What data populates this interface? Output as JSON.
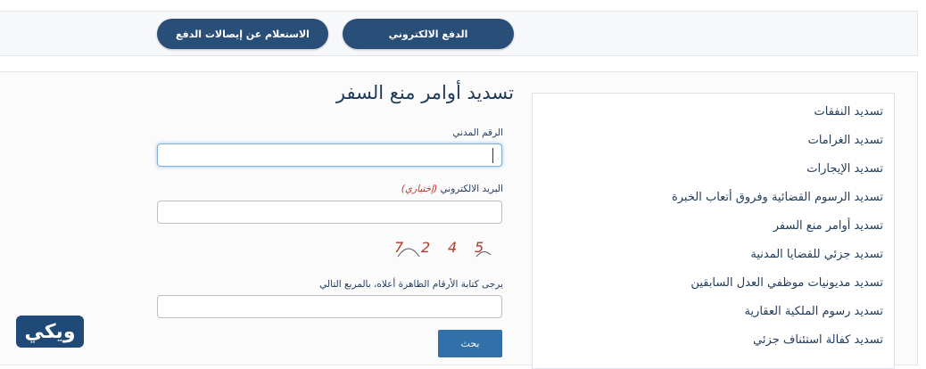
{
  "nav": {
    "epay_label": "الدفع الالكتروني",
    "receipts_label": "الاستعلام عن إيصالات الدفع"
  },
  "sidebar": {
    "items": [
      {
        "label": "تسديد النفقات"
      },
      {
        "label": "تسديد الغرامات"
      },
      {
        "label": "تسديد الإيجارات"
      },
      {
        "label": "تسديد الرسوم القضائية وفروق أتعاب الخبرة"
      },
      {
        "label": "تسديد أوامر منع السفر"
      },
      {
        "label": "تسديد جزئي للقضايا المدنية"
      },
      {
        "label": "تسديد مديونيات موظفي العدل السابقين"
      },
      {
        "label": "تسديد رسوم الملكية العقارية"
      },
      {
        "label": "تسديد كفالة استئناف جزئي"
      }
    ]
  },
  "form": {
    "title": "تسديد أوامر منع السفر",
    "civil_id_label": "الرقم المدني",
    "civil_id_value": "",
    "email_label": "البريد الالكتروني",
    "email_optional": "(إختياري)",
    "email_value": "",
    "captcha_digits": [
      "7",
      "2",
      "4",
      "5"
    ],
    "captcha_instruction": "يرجى كتابة الأرقام الظاهرة أعلاه، بالمربع التالي",
    "captcha_value": "",
    "search_button": "بحث"
  },
  "watermark": {
    "logo_text": "ويكي"
  },
  "colors": {
    "nav_pill": "#294e77",
    "button": "#3170a8",
    "text": "#1f3a5a"
  }
}
